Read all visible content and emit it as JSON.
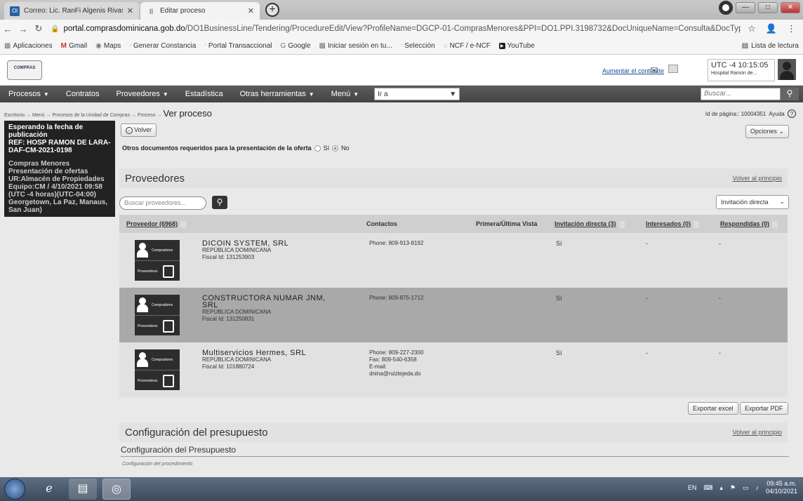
{
  "browser": {
    "tabs": [
      {
        "favicon": "Ol",
        "title": "Correo: Lic. RanFi Algenis Rivas"
      },
      {
        "favicon": "॥",
        "title": "Editar proceso"
      }
    ],
    "url_host": "portal.comprasdominicana.gob.do",
    "url_path": "/DO1BusinessLine/Tendering/ProcedureEdit/View?ProfileName=DGCP-01-ComprasMenores&PPI=DO1.PPI.3198732&DocUniqueName=Consulta&DocType...",
    "bookmarks": [
      {
        "icon": "apps-icon",
        "label": "Aplicaciones"
      },
      {
        "icon": "gmail-icon",
        "label": "Gmail"
      },
      {
        "icon": "maps-icon",
        "label": "Maps"
      },
      {
        "icon": "page-icon",
        "label": "Generar Constancia"
      },
      {
        "icon": "page-icon",
        "label": "Portal Transaccional"
      },
      {
        "icon": "google-icon",
        "label": "Google"
      },
      {
        "icon": "microsoft-icon",
        "label": "Iniciar sesión en tu..."
      },
      {
        "icon": "page-icon",
        "label": "Selección"
      },
      {
        "icon": "circle-icon",
        "label": "NCF / e-NCF"
      },
      {
        "icon": "youtube-icon",
        "label": "YouTube"
      }
    ],
    "reading_list": "Lista de lectura"
  },
  "header": {
    "logo_text": "COMPRAS",
    "contrast_link": "Aumentar el contraste",
    "utc_time": "UTC -4 10:15:05",
    "hospital": "Hospital Ramón de..."
  },
  "nav": {
    "items": [
      {
        "label": "Procesos",
        "caret": "▼"
      },
      {
        "label": "Contratos",
        "caret": ""
      },
      {
        "label": "Proveedores",
        "caret": "▼"
      },
      {
        "label": "Estadística",
        "caret": ""
      },
      {
        "label": "Otras herramientas",
        "caret": "▼"
      },
      {
        "label": "Menú",
        "caret": "▼"
      }
    ],
    "goto_value": "Ir a",
    "search_placeholder": "Buscar..."
  },
  "breadcrumb": {
    "trail": "Escritorio → Menú → Procesos de la Unidad de Compras → Proceso →",
    "current": "Ver proceso",
    "page_id": "Id de página:: 10004351",
    "help": "Ayuda"
  },
  "left_panel": {
    "status": "Esperando la fecha de publicación",
    "ref": "REF: HOSP RAMON DE LARA-DAF-CM-2021-0198",
    "details": "Compras Menores Presentación de ofertas UR:Almacén de Propiedades Equipo:CM / 4/10/2021 09:58 (UTC -4 horas)(UTC-04:00) Georgetown, La Paz, Manaus, San Juan)"
  },
  "content": {
    "back_label": "Volver",
    "options_label": "Opciones",
    "other_docs_label": "Otros documentos requeridos para la presentación de la oferta",
    "radio_yes": "Sí",
    "radio_no": "No",
    "proveedores_title": "Proveedores",
    "back_to_top": "Volver al principio",
    "supplier_search_placeholder": "Buscar proveedores...",
    "invitation_filter": "Invitación directa",
    "table_headers": {
      "supplier": "Proveedor (6968)",
      "contacts": "Contactos",
      "first_last_view": "Primera/Última Vista",
      "direct_invitation": "Invitación directa (3)",
      "interested": "Interesados (0)",
      "responded": "Respondidas (0)"
    },
    "logo_labels": {
      "top": "Compradores",
      "bottom": "Proveedores"
    },
    "suppliers": [
      {
        "name": "DICOIN SYSTEM, SRL",
        "country": "REPÚBLICA DOMINICANA",
        "fiscal": "Fiscal Id: 131253903",
        "contact": "Phone: 809-913-8192",
        "invitation": "Sí",
        "interested": "-",
        "responded": "-"
      },
      {
        "name": "CONSTRUCTORA NUMAR JNM, SRL",
        "country": "REPÚBLICA DOMINICANA",
        "fiscal": "Fiscal Id: 131250831",
        "contact": "Phone: 809-875-1712",
        "invitation": "Sí",
        "interested": "-",
        "responded": "-"
      },
      {
        "name": "Multiservicios Hermes, SRL",
        "country": "REPÚBLICA DOMINICANA",
        "fiscal": "Fiscal Id: 101880724",
        "contact": "Phone: 809-227-2300\nFax: 809-540-6358\nE-mail:\ndnina@ruiztejeda.do",
        "invitation": "Sí",
        "interested": "-",
        "responded": "-"
      }
    ],
    "export_excel": "Exportar excel",
    "export_pdf": "Exportar PDF",
    "budget_title": "Configuración del presupuesto",
    "budget_subtitle": "Configuración del Presupuesto",
    "budget_note": "Configuración del procedimiento"
  },
  "taskbar": {
    "lang": "EN",
    "time": "09:45 a.m.",
    "date": "04/10/2021"
  }
}
